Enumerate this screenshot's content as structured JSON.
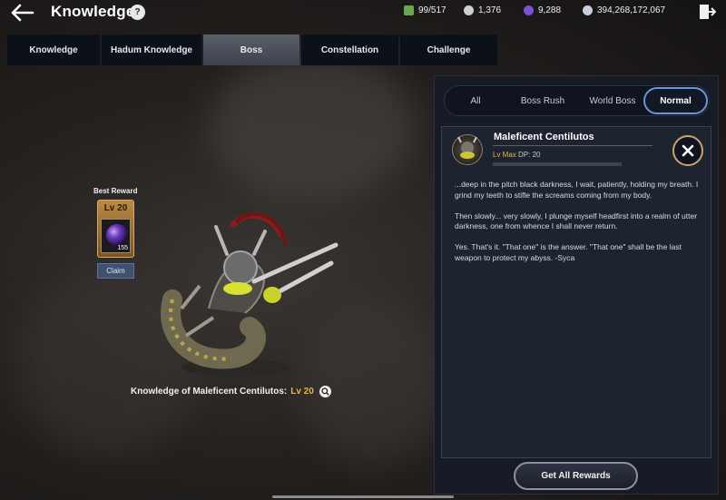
{
  "header": {
    "title": "Knowledge",
    "currencies": [
      {
        "icon": "green-scroll-icon",
        "value": "99/517",
        "color": "#6aa84f"
      },
      {
        "icon": "silver-coin-icon",
        "value": "1,376",
        "color": "#d0d0d0"
      },
      {
        "icon": "purple-shard-icon",
        "value": "9,288",
        "color": "#7b4fd6"
      },
      {
        "icon": "silver-icon",
        "value": "394,268,172,067",
        "color": "#c8d0dc"
      }
    ]
  },
  "tabs": [
    {
      "label": "Knowledge"
    },
    {
      "label": "Hadum Knowledge"
    },
    {
      "label": "Boss",
      "active": true
    },
    {
      "label": "Constellation"
    },
    {
      "label": "Challenge"
    }
  ],
  "best_reward": {
    "label": "Best Reward",
    "level": "Lv 20",
    "count": "155",
    "claim_label": "Claim"
  },
  "knowledge": {
    "label": "Knowledge of Maleficent Centilutos:",
    "level": "Lv 20"
  },
  "filters": [
    {
      "label": "All"
    },
    {
      "label": "Boss Rush"
    },
    {
      "label": "World Boss"
    },
    {
      "label": "Normal",
      "active": true
    }
  ],
  "boss": {
    "name": "Maleficent Centilutos",
    "level": "Lv Max",
    "dp": "DP: 20",
    "description": [
      "...deep in the pitch black darkness, I wait, patiently, holding my breath. I grind my teeth to stifle the screams coming from my body.",
      "Then slowly... very slowly, I plunge myself headfirst into a realm of utter darkness, one from whence I shall never return.",
      "Yes. That's it. \"That one\" is the answer. \"That one\" shall be the last weapon to protect my abyss. -Syca"
    ]
  },
  "get_all_rewards_label": "Get All Rewards",
  "colors": {
    "accent_gold": "#e3b54c",
    "active_filter_border": "#6f93d6",
    "panel_bg": "#171b26"
  }
}
